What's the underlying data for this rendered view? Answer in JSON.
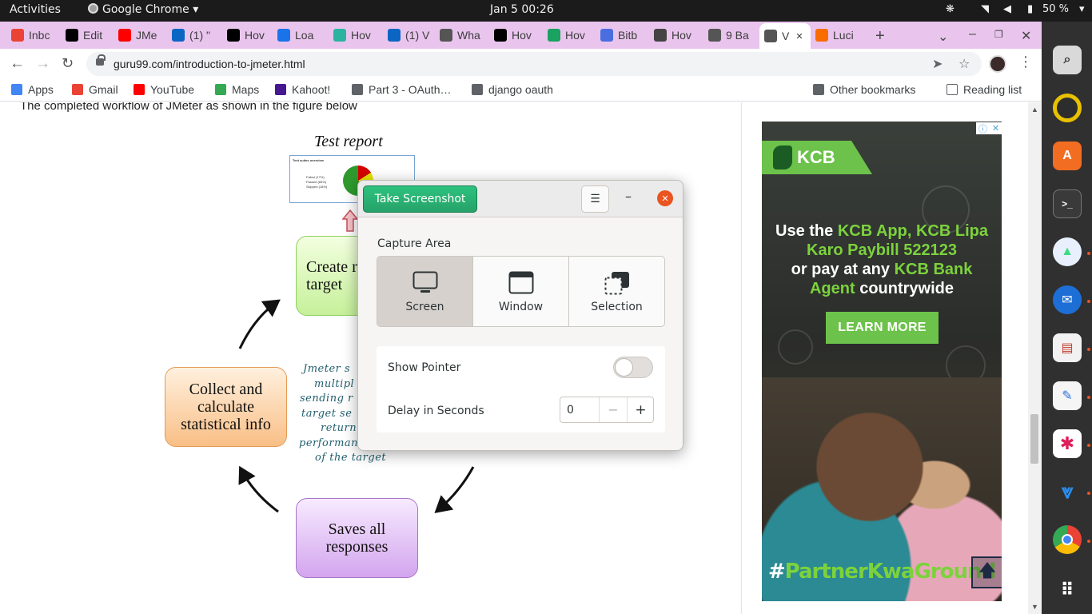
{
  "topbar": {
    "activities": "Activities",
    "app_name": "Google Chrome",
    "clock": "Jan 5  00:26",
    "battery": "50 %"
  },
  "tabs": [
    {
      "label": "Inbc",
      "icon": "gmail-icon",
      "color": "#ea4335"
    },
    {
      "label": "Edit",
      "icon": "medium-icon",
      "color": "#000000"
    },
    {
      "label": "JMe",
      "icon": "youtube-icon",
      "color": "#ff0000"
    },
    {
      "label": "(1) \"",
      "icon": "linkedin-icon",
      "color": "#0a66c2"
    },
    {
      "label": "Hov",
      "icon": "medium-icon",
      "color": "#000000"
    },
    {
      "label": "Loa",
      "icon": "edx-icon",
      "color": "#1a73e8"
    },
    {
      "label": "Hov",
      "icon": "dm-icon",
      "color": "#2bb3a0"
    },
    {
      "label": "(1) V",
      "icon": "linkedin-icon",
      "color": "#0a66c2"
    },
    {
      "label": "Wha",
      "icon": "globe-icon",
      "color": "#555555"
    },
    {
      "label": "Hov",
      "icon": "dev-icon",
      "color": "#000000"
    },
    {
      "label": "Hov",
      "icon": "ut-icon",
      "color": "#1aa260"
    },
    {
      "label": "Bitb",
      "icon": "doc-icon",
      "color": "#4a6ee0"
    },
    {
      "label": "Hov",
      "icon": "feather-icon",
      "color": "#444444"
    },
    {
      "label": "9 Ba",
      "icon": "globe-icon",
      "color": "#555555"
    },
    {
      "label": "V",
      "icon": "globe-icon",
      "color": "#555555",
      "active": true
    },
    {
      "label": "Luci",
      "icon": "lucid-icon",
      "color": "#f96c00"
    }
  ],
  "toolbar": {
    "url": "guru99.com/introduction-to-jmeter.html"
  },
  "bookmarks": [
    {
      "label": "Apps",
      "icon": "apps-grid-icon",
      "color": "#4285f4"
    },
    {
      "label": "Gmail",
      "icon": "gmail-icon",
      "color": "#ea4335"
    },
    {
      "label": "YouTube",
      "icon": "youtube-icon",
      "color": "#ff0000"
    },
    {
      "label": "Maps",
      "icon": "maps-pin-icon",
      "color": "#34a853"
    },
    {
      "label": "Kahoot!",
      "icon": "kahoot-icon",
      "color": "#46178f"
    },
    {
      "label": "Part 3 - OAuth…",
      "icon": "page-icon",
      "color": "#5f6368"
    },
    {
      "label": "django oauth",
      "icon": "folder-icon",
      "color": "#5f6368"
    }
  ],
  "bookmarks_right": {
    "other": "Other bookmarks",
    "reading": "Reading list"
  },
  "article": {
    "intro": "The completed workflow of JMeter as shown in the figure below",
    "test_report": "Test report",
    "report_thumb_title": "Test suites overview",
    "report_thumb_legend": [
      "Failed (17%)",
      "Passed (65%)",
      "Skipped (18%)"
    ],
    "box_create": "Create request to target",
    "box_collect": "Collect and calculate statistical info",
    "box_saves": "Saves all responses",
    "jmeter_note_lines": [
      "Jmeter s",
      "multipl",
      "sending r",
      "target se",
      "return",
      "performan",
      "of the target"
    ]
  },
  "ad": {
    "brand": "KCB",
    "copy_line1_a": "Use the ",
    "copy_line1_b": "KCB App, KCB Lipa",
    "copy_line2": "Karo Paybill 522123",
    "copy_line3": "or pay at any ",
    "copy_line3_b": "KCB Bank",
    "copy_line4_a": "Agent",
    "copy_line4_b": " countrywide",
    "cta": "LEARN MORE",
    "tag_hash": "#",
    "tag_a": "Partner",
    "tag_b": "KwaGround",
    "accent_color": "#6cc24a"
  },
  "dialog": {
    "take_screenshot": "Take Screenshot",
    "capture_area": "Capture Area",
    "modes": [
      "Screen",
      "Window",
      "Selection"
    ],
    "selected_mode": "Screen",
    "show_pointer": "Show Pointer",
    "show_pointer_on": false,
    "delay_label": "Delay in Seconds",
    "delay_value": "0",
    "accent_color": "#26a269",
    "close_color": "#e95420"
  },
  "dock": [
    {
      "icon": "search-icon"
    },
    {
      "icon": "rhythmbox-icon"
    },
    {
      "icon": "software-center-icon"
    },
    {
      "icon": "terminal-icon"
    },
    {
      "icon": "android-studio-icon"
    },
    {
      "icon": "thunderbird-icon"
    },
    {
      "icon": "document-viewer-icon"
    },
    {
      "icon": "text-editor-icon"
    },
    {
      "icon": "slack-icon"
    },
    {
      "icon": "vscode-icon"
    },
    {
      "icon": "chrome-icon"
    },
    {
      "icon": "show-apps-icon"
    }
  ]
}
